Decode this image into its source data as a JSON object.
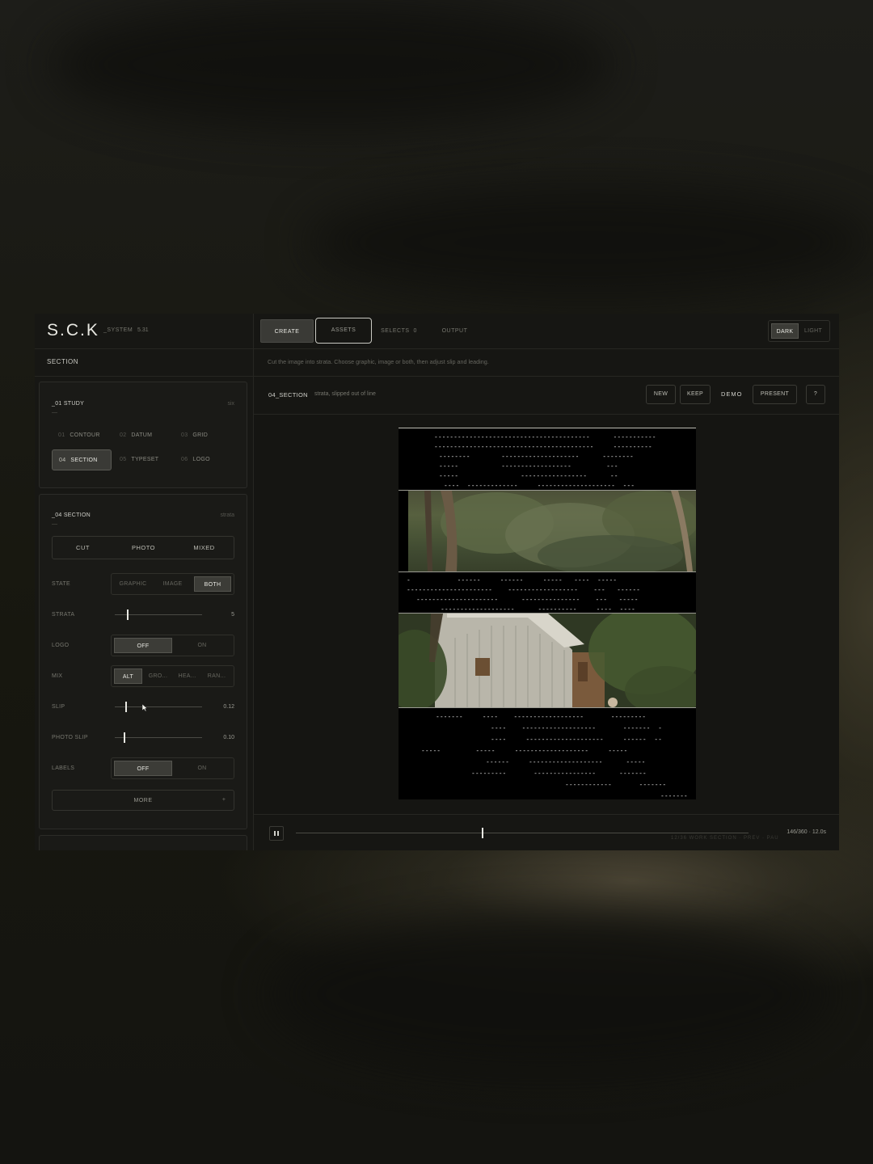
{
  "brand": {
    "name": "S.C.K",
    "system": "_SYSTEM",
    "version": "5.31"
  },
  "sidebar": {
    "section_label": "SECTION",
    "study": {
      "title": "_01 STUDY",
      "tag": "six",
      "dash": "—",
      "modules": [
        {
          "num": "01",
          "label": "CONTOUR",
          "active": false
        },
        {
          "num": "02",
          "label": "DATUM",
          "active": false
        },
        {
          "num": "03",
          "label": "GRID",
          "active": false
        },
        {
          "num": "04",
          "label": "SECTION",
          "active": true
        },
        {
          "num": "05",
          "label": "TYPESET",
          "active": false
        },
        {
          "num": "06",
          "label": "LOGO",
          "active": false
        }
      ]
    },
    "section": {
      "title": "_04 SECTION",
      "tag": "strata",
      "dash": "—",
      "modes": [
        "CUT",
        "PHOTO",
        "MIXED"
      ],
      "state": {
        "label": "STATE",
        "options": [
          "GRAPHIC",
          "IMAGE",
          "BOTH"
        ],
        "selected": "BOTH"
      },
      "strata": {
        "label": "STRATA",
        "value": "5",
        "fraction": 0.14
      },
      "logo": {
        "label": "LOGO",
        "options": [
          "OFF",
          "ON"
        ],
        "selected": "OFF"
      },
      "mix": {
        "label": "MIX",
        "options": [
          "ALT",
          "GRO...",
          "HEA...",
          "RAN..."
        ],
        "selected": "ALT"
      },
      "slip": {
        "label": "SLIP",
        "value": "0.12",
        "fraction": 0.12
      },
      "photo_slip": {
        "label": "PHOTO SLIP",
        "value": "0.10",
        "fraction": 0.1
      },
      "labels": {
        "label": "LABELS",
        "options": [
          "OFF",
          "ON"
        ],
        "selected": "OFF"
      },
      "more": {
        "label": "MORE",
        "icon": "+"
      }
    }
  },
  "topbar": {
    "tabs": [
      {
        "label": "CREATE",
        "active": true
      },
      {
        "label": "ASSETS",
        "focused": true
      },
      {
        "label": "SELECTS",
        "count": "0"
      },
      {
        "label": "OUTPUT"
      }
    ],
    "theme": {
      "options": [
        "DARK",
        "LIGHT"
      ],
      "selected": "DARK"
    }
  },
  "instructions": "Cut the image into strata. Choose graphic, image or both, then adjust slip and leading.",
  "context": {
    "title": "04_SECTION",
    "subtitle": "strata, slipped out of line",
    "buttons": {
      "new": "NEW",
      "keep": "KEEP",
      "demo": "DEMO",
      "present": "PRESENT",
      "help": "?"
    }
  },
  "playback": {
    "time": "146/360 · 12.0s",
    "progress": 0.41,
    "faint": "12/36  WORK  SECTION  ·  PREV  ·  PAU"
  },
  "colors": {
    "accent": "#e8e8e2",
    "panel": "#1a1a17",
    "bg": "#161613"
  }
}
